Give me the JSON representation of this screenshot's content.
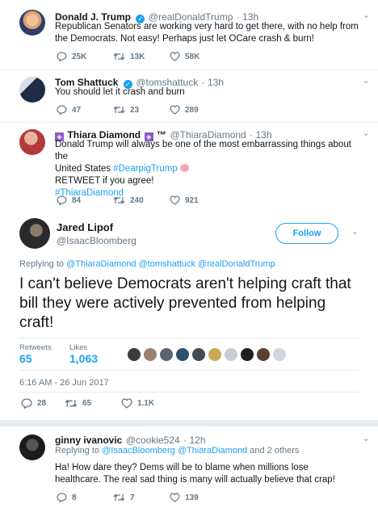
{
  "tweets": [
    {
      "name": "Donald J. Trump",
      "handle": "@realDonaldTrump",
      "time": "· 13h",
      "text": "Republican Senators are working very hard to get there, with no help from the Democrats. Not easy! Perhaps just let OCare crash & burn!",
      "replies": "25K",
      "retweets": "13K",
      "likes": "58K"
    },
    {
      "name": "Tom Shattuck",
      "handle": "@tomshattuck",
      "time": "· 13h",
      "text": "You should let it crash and burn",
      "replies": "47",
      "retweets": "23",
      "likes": "289"
    },
    {
      "name": "Thiara Diamond",
      "name_suffix": "™",
      "handle": "@ThiaraDiamond",
      "time": "· 13h",
      "text_line1": "Donald Trump will always be one of the most embarrassing things about the",
      "text_line2_prefix": "United States ",
      "hashtag1": "#DearpigTrump",
      "text_line3": "RETWEET if you agree!",
      "hashtag2": "#ThiaraDiamond",
      "replies": "84",
      "retweets": "240",
      "likes": "921"
    }
  ],
  "main": {
    "name": "Jared Lipof",
    "handle": "@IsaacBloomberg",
    "follow_label": "Follow",
    "replying_prefix": "Replying to",
    "reply_to": "@ThiaraDiamond @tomshattuck @realDonaldTrump",
    "text": "I can't believe Democrats aren't helping craft that bill they were actively prevented from helping craft!",
    "retweets_label": "Retweets",
    "retweets_value": "65",
    "likes_label": "Likes",
    "likes_value": "1,063",
    "timestamp": "6:16 AM - 26 Jun 2017",
    "replies": "28",
    "retweets": "65",
    "likes": "1.1K"
  },
  "reply": {
    "name": "ginny ivanovic",
    "handle": "@cookie524",
    "time": "· 12h",
    "replying_prefix": "Replying to",
    "reply_to": "@IsaacBloomberg @ThiaraDiamond",
    "reply_to_suffix": "and 2 others",
    "text": "Ha! How dare they? Dems will be to blame when millions lose healthcare. The real sad thing is many will actually believe that crap!",
    "replies": "8",
    "retweets": "7",
    "likes": "139"
  },
  "colors": {
    "accent": "#1da1f2",
    "muted": "#657786",
    "divider": "#e6ecf0"
  },
  "icons": [
    "reply-icon",
    "retweet-icon",
    "like-icon",
    "chevron-down-icon",
    "verified-badge-icon",
    "pig-emoji-icon"
  ]
}
